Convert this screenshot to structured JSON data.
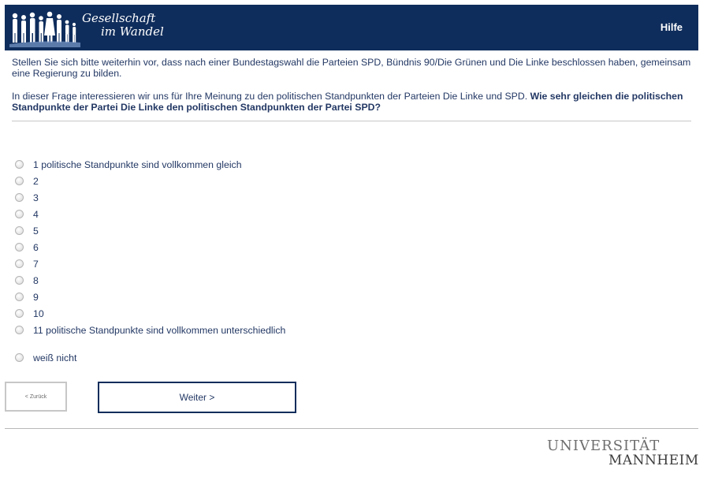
{
  "header": {
    "logo_line1": "Gesellschaft",
    "logo_line2": "im Wandel",
    "help_label": "Hilfe",
    "background_color": "#0f2d5c"
  },
  "question": {
    "intro": "Stellen Sie sich bitte weiterhin vor, dass nach einer Bundestagswahl die Parteien SPD, Bündnis 90/Die Grünen und Die Linke beschlossen haben, gemeinsam eine Regierung zu bilden.",
    "context": "In dieser Frage interessieren wir uns für Ihre Meinung zu den politischen Standpunkten der Parteien Die Linke und SPD.",
    "prompt": "Wie sehr gleichen die politischen Standpunkte der Partei Die Linke den politischen Standpunkten der Partei SPD?"
  },
  "options": [
    "1 politische Standpunkte sind vollkommen gleich",
    "2",
    "3",
    "4",
    "5",
    "6",
    "7",
    "8",
    "9",
    "10",
    "11 politische Standpunkte sind vollkommen unterschiedlich"
  ],
  "option_dont_know": "weiß nicht",
  "navigation": {
    "back_label": "< Zurück",
    "next_label": "Weiter >"
  },
  "footer": {
    "university_line1": "UNIVERSITÄT",
    "university_line2": "MANNHEIM"
  }
}
